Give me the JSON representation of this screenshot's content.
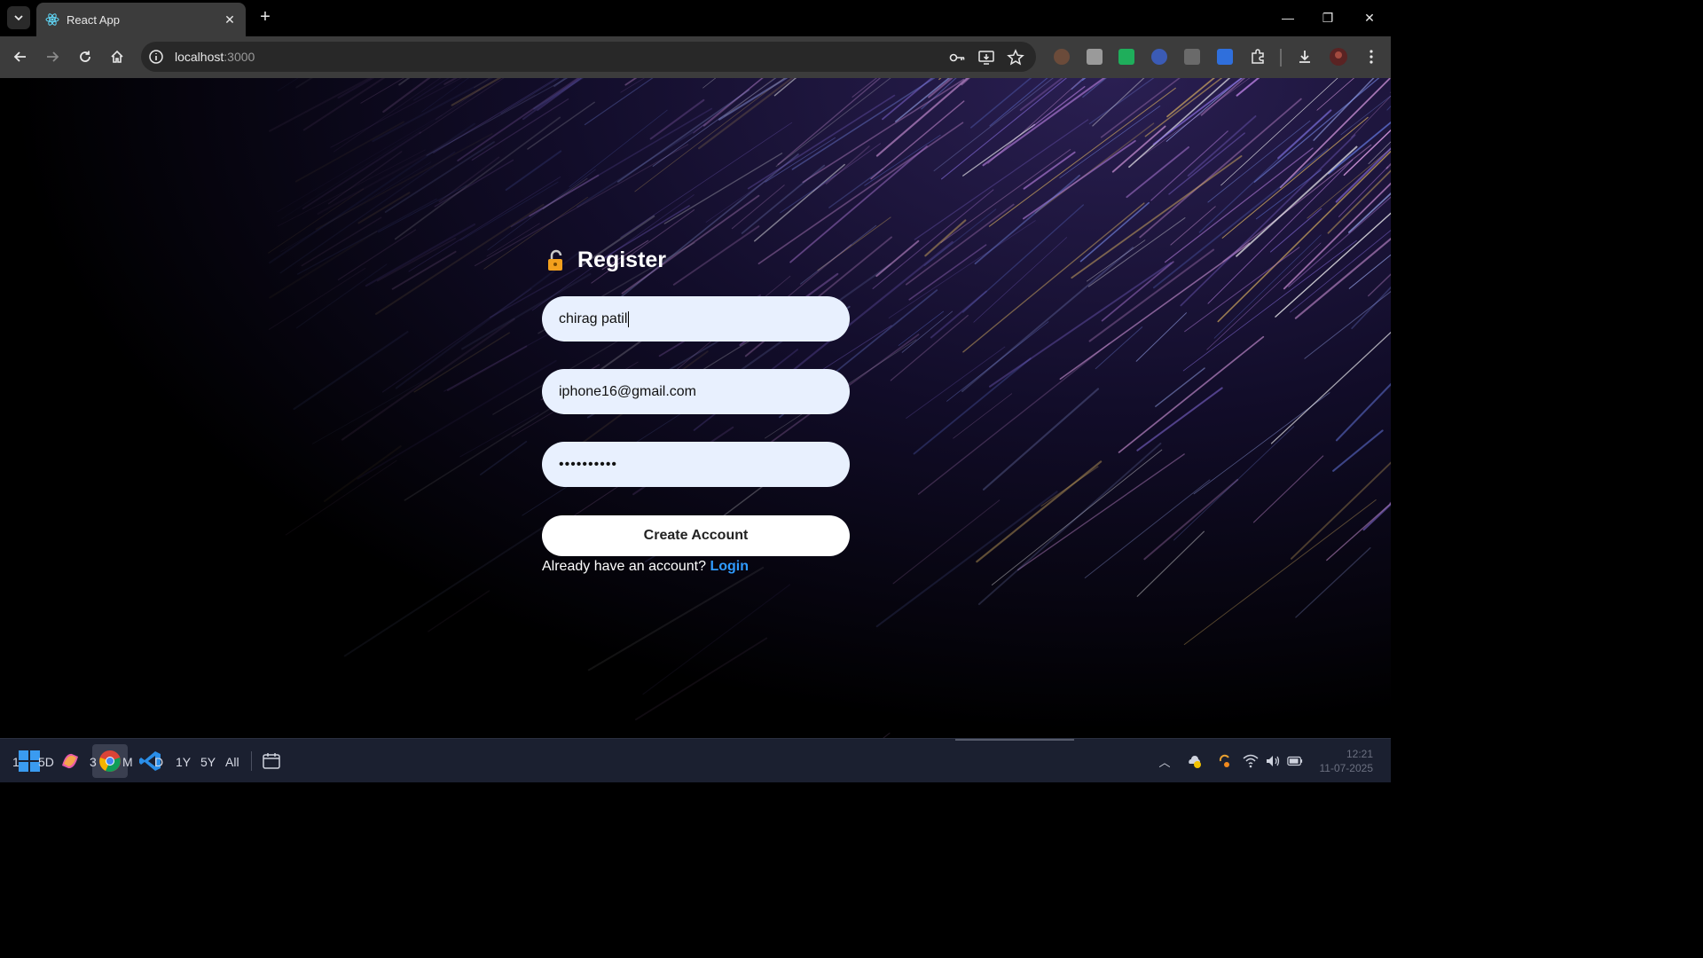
{
  "browser": {
    "tab_title": "React App",
    "url_host": "localhost",
    "url_port": ":3000"
  },
  "form": {
    "heading": "Register",
    "name_value": "chirag patil",
    "email_value": "iphone16@gmail.com",
    "password_mask": "••••••••••",
    "submit_label": "Create Account",
    "login_prompt": "Already have an account?",
    "login_link": "Login"
  },
  "taskbar": {
    "labels": [
      "1",
      "5D",
      "3",
      "M",
      "D",
      "1Y",
      "5Y",
      "All"
    ],
    "time": "12:21",
    "date": "11-07-2025"
  },
  "colors": {
    "input_bg": "#e8f0fe",
    "link": "#2f9bff",
    "chrome_bg": "#3c3c3c"
  }
}
